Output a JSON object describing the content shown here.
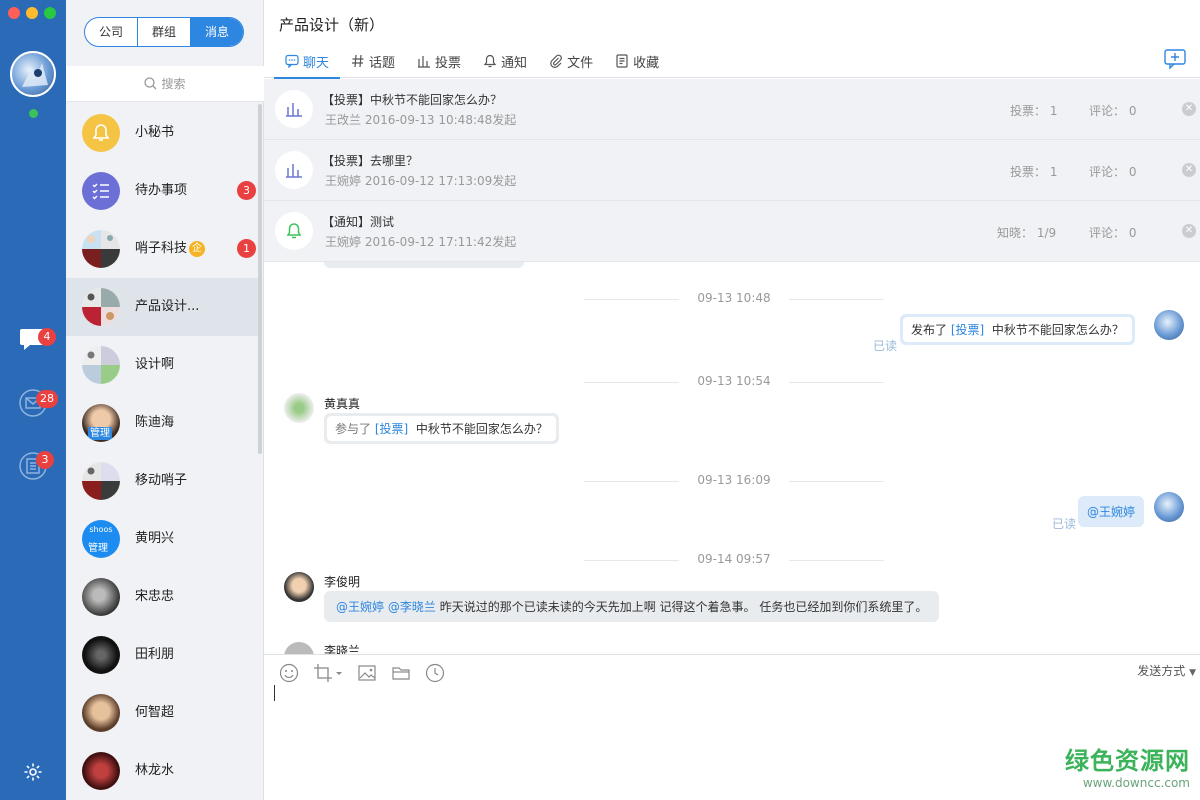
{
  "rail": {
    "badges": {
      "chat": "4",
      "mail": "28",
      "notes": "3"
    },
    "colors": {
      "background": "#2a6ab7",
      "close": "#fe5f57",
      "minimize": "#febb2e",
      "maximize": "#28c840"
    }
  },
  "sidebar": {
    "segments": [
      "公司",
      "群组",
      "消息"
    ],
    "search_placeholder": "搜索",
    "contacts": [
      {
        "name": "小秘书",
        "badge": ""
      },
      {
        "name": "待办事项",
        "badge": "3"
      },
      {
        "name": "哨子科技",
        "badge": "1",
        "tag": "企"
      },
      {
        "name": "产品设计...",
        "badge": ""
      },
      {
        "name": "设计啊",
        "badge": ""
      },
      {
        "name": "陈迪海",
        "badge": "",
        "role": "管理"
      },
      {
        "name": "移动哨子",
        "badge": ""
      },
      {
        "name": "黄明兴",
        "badge": "",
        "role": "管理",
        "brand": "shoos"
      },
      {
        "name": "宋忠忠",
        "badge": ""
      },
      {
        "name": "田利朋",
        "badge": ""
      },
      {
        "name": "何智超",
        "badge": ""
      },
      {
        "name": "林龙水",
        "badge": ""
      }
    ]
  },
  "main": {
    "title": "产品设计（新）",
    "tabs": [
      "聊天",
      "话题",
      "投票",
      "通知",
      "文件",
      "收藏"
    ],
    "pinned": [
      {
        "title": "【投票】中秋节不能回家怎么办？",
        "sub": "王改兰 2016-09-13 10:48:48发起",
        "stat1": "投票： 1",
        "stat2": "评论： 0"
      },
      {
        "title": "【投票】去哪里？",
        "sub": "王婉婷 2016-09-12 17:13:09发起",
        "stat1": "投票： 1",
        "stat2": "评论： 0"
      },
      {
        "title": "【通知】测试",
        "sub": "王婉婷 2016-09-12 17:11:42发起",
        "stat1": "知晓： 1/9",
        "stat2": "评论： 0"
      }
    ],
    "chat": {
      "times": [
        "09-13 10:48",
        "09-13 10:54",
        "09-13 16:09",
        "09-14 09:57"
      ],
      "read_label": "已读",
      "m1": {
        "prefix": "发布了",
        "tag": "[投票]",
        "text": "中秋节不能回家怎么办？"
      },
      "m2": {
        "sender": "黄真真",
        "prefix": "参与了",
        "tag": "[投票]",
        "text": "中秋节不能回家怎么办？"
      },
      "m3": {
        "mention": "@王婉婷"
      },
      "m4": {
        "sender": "李俊明",
        "mention1": "@王婉婷",
        "mention2": "@李晓兰",
        "text": "昨天说过的那个已读未读的今天先加上啊  记得这个着急事。 任务也已经加到你们系统里了。"
      },
      "m5": {
        "sender": "李晓兰"
      }
    },
    "composer": {
      "send_mode": "发送方式"
    }
  },
  "watermark": {
    "line1": "绿色资源网",
    "line2": "www.downcc.com"
  }
}
